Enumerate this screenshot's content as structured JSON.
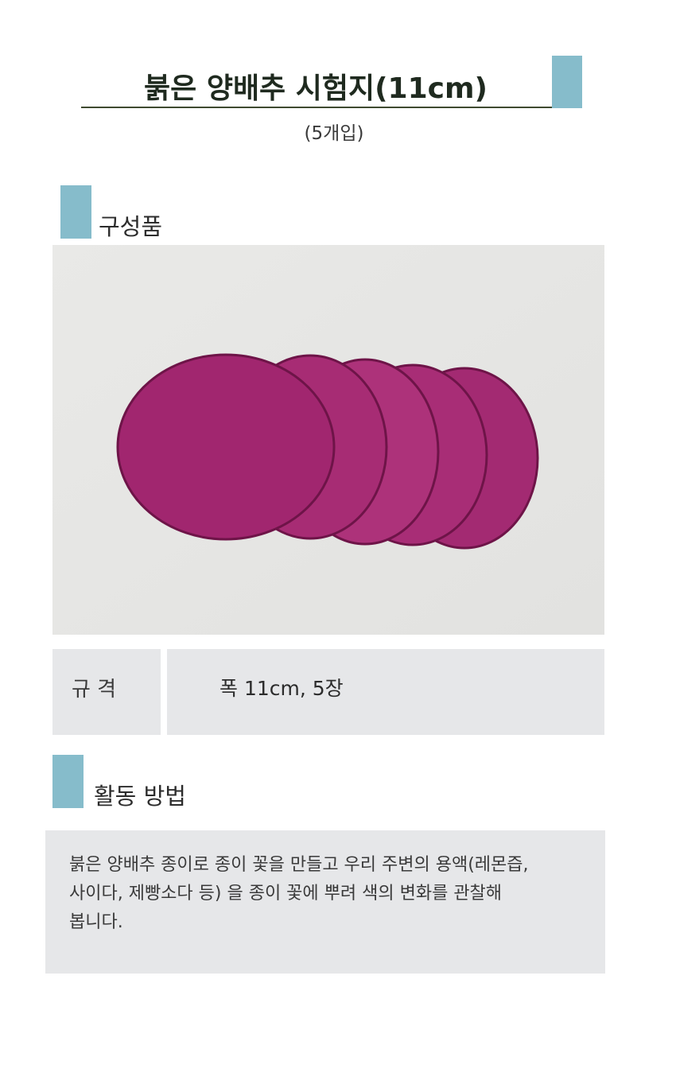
{
  "header": {
    "title": "붉은 양배추 시험지(11cm)",
    "subtitle": "(5개입)"
  },
  "components": {
    "heading": "구성품",
    "image": {
      "description_icon": "red-cabbage-paper-discs"
    }
  },
  "spec": {
    "label": "규 격",
    "value": "폭 11cm, 5장"
  },
  "method": {
    "heading": "활동 방법",
    "lines": [
      "붉은 양배추 종이로 종이 꽃을 만들고 우리 주변의 용액(레몬즙,",
      "사이다, 제빵소다 등) 을 종이 꽃에 뿌려 색의 변화를 관찰해",
      "봅니다."
    ]
  },
  "colors": {
    "accent": "#86bccb",
    "panel": "#e6e7e9",
    "disc": "#a0246e"
  }
}
